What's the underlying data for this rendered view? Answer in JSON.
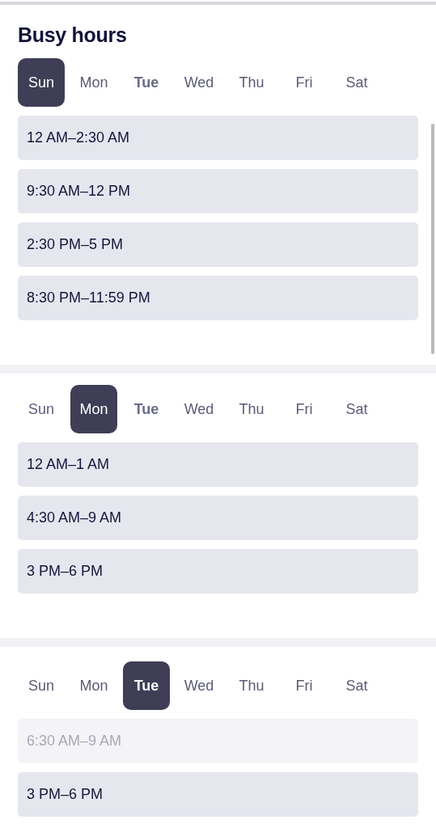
{
  "title": "Busy hours",
  "sections": [
    {
      "days": [
        {
          "label": "Sun",
          "selected": true,
          "today": false
        },
        {
          "label": "Mon",
          "selected": false,
          "today": false
        },
        {
          "label": "Tue",
          "selected": false,
          "today": true
        },
        {
          "label": "Wed",
          "selected": false,
          "today": false
        },
        {
          "label": "Thu",
          "selected": false,
          "today": false
        },
        {
          "label": "Fri",
          "selected": false,
          "today": false
        },
        {
          "label": "Sat",
          "selected": false,
          "today": false
        }
      ],
      "slots": [
        {
          "label": "12 AM–2:30 AM",
          "past": false
        },
        {
          "label": "9:30 AM–12 PM",
          "past": false
        },
        {
          "label": "2:30 PM–5 PM",
          "past": false
        },
        {
          "label": "8:30 PM–11:59 PM",
          "past": false
        }
      ]
    },
    {
      "days": [
        {
          "label": "Sun",
          "selected": false,
          "today": false
        },
        {
          "label": "Mon",
          "selected": true,
          "today": false
        },
        {
          "label": "Tue",
          "selected": false,
          "today": true
        },
        {
          "label": "Wed",
          "selected": false,
          "today": false
        },
        {
          "label": "Thu",
          "selected": false,
          "today": false
        },
        {
          "label": "Fri",
          "selected": false,
          "today": false
        },
        {
          "label": "Sat",
          "selected": false,
          "today": false
        }
      ],
      "slots": [
        {
          "label": "12 AM–1 AM",
          "past": false
        },
        {
          "label": "4:30 AM–9 AM",
          "past": false
        },
        {
          "label": "3 PM–6 PM",
          "past": false
        }
      ]
    },
    {
      "days": [
        {
          "label": "Sun",
          "selected": false,
          "today": false
        },
        {
          "label": "Mon",
          "selected": false,
          "today": false
        },
        {
          "label": "Tue",
          "selected": true,
          "today": true
        },
        {
          "label": "Wed",
          "selected": false,
          "today": false
        },
        {
          "label": "Thu",
          "selected": false,
          "today": false
        },
        {
          "label": "Fri",
          "selected": false,
          "today": false
        },
        {
          "label": "Sat",
          "selected": false,
          "today": false
        }
      ],
      "slots": [
        {
          "label": "6:30 AM–9 AM",
          "past": true
        },
        {
          "label": "3 PM–6 PM",
          "past": false
        }
      ]
    }
  ]
}
